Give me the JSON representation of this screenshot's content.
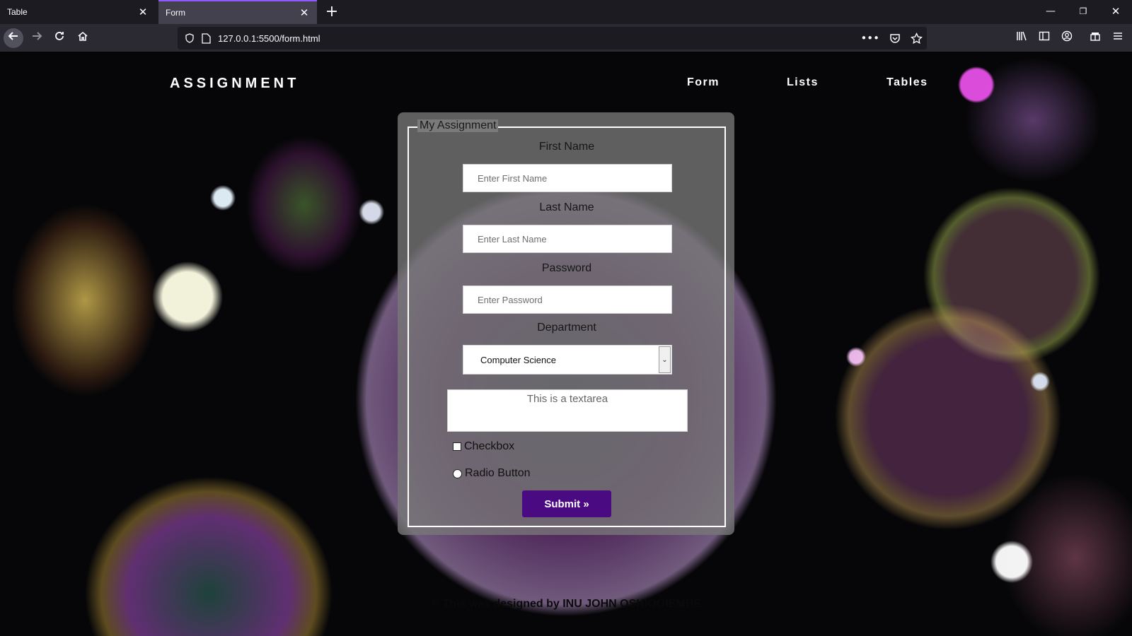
{
  "browser": {
    "tabs": [
      {
        "title": "Table",
        "close": "✕"
      },
      {
        "title": "Form",
        "close": "✕"
      }
    ],
    "new_tab": "+",
    "url": "127.0.0.1:5500/form.html",
    "url_actions": {
      "more": "•••"
    },
    "window_controls": {
      "minimize": "—",
      "restore": "❐",
      "close": "✕"
    }
  },
  "site": {
    "logo": "ASSIGNMENT",
    "nav": [
      "Form",
      "Lists",
      "Tables"
    ]
  },
  "form": {
    "legend": "My Assignment",
    "first_name": {
      "label": "First Name",
      "placeholder": "Enter First Name"
    },
    "last_name": {
      "label": "Last Name",
      "placeholder": "Enter Last Name"
    },
    "password": {
      "label": "Password",
      "placeholder": "Enter Password"
    },
    "department": {
      "label": "Department",
      "selected": "Computer Science",
      "arrow": "⌄"
    },
    "textarea": {
      "text": "This is a textarea"
    },
    "checkbox_label": "Checkbox",
    "radio_label": "Radio Button",
    "submit": "Submit »"
  },
  "footer": {
    "text": "© This was designed by INU JOHN OSHIOGIEMHE"
  },
  "colors": {
    "accent": "#4a0a82",
    "card": "#787878",
    "chrome": "#2b2a33",
    "tab_highlight": "#9059ff"
  },
  "icons": [
    "back-arrow-icon",
    "forward-arrow-icon",
    "reload-icon",
    "home-icon",
    "shield-icon",
    "page-icon",
    "pocket-icon",
    "bookmark-star-icon",
    "library-icon",
    "sidebar-icon",
    "account-icon",
    "extensions-icon",
    "menu-icon"
  ]
}
